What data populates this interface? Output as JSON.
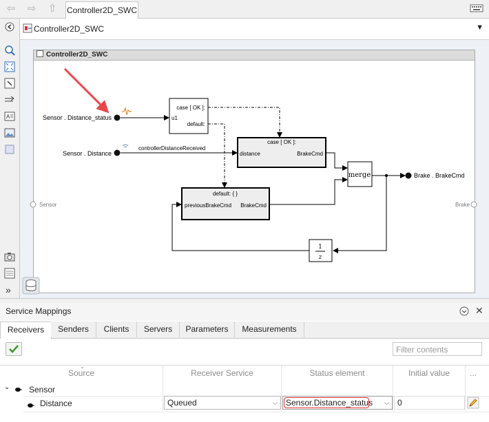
{
  "topbar": {
    "tab_label": "Controller2D_SWC"
  },
  "address": {
    "path": "Controller2D_SWC"
  },
  "subsystem": {
    "title": "Controller2D_SWC"
  },
  "diagram": {
    "port_left": "Sensor",
    "port_right": "Brake",
    "sig_status": "Sensor . Distance_status",
    "sig_distance": "Sensor . Distance",
    "sig_brake": "Brake . BrakeCmd",
    "line_label": "controllerDistanceReceived",
    "switch_case": "case [ OK ]:",
    "switch_default": "default:",
    "switch_input": "u1",
    "case_block_title": "case [ OK ]:",
    "case_in": "distance",
    "case_out": "BrakeCmd",
    "default_block_title": "default: { }",
    "default_in": "previousBrakeCmd",
    "default_out": "BrakeCmd",
    "merge_label": "merge",
    "delay_num": "1",
    "delay_den": "z"
  },
  "panel": {
    "title": "Service Mappings",
    "tabs": [
      "Receivers",
      "Senders",
      "Clients",
      "Servers",
      "Parameters",
      "Measurements"
    ],
    "filter_placeholder": "Filter contents",
    "columns": [
      "Source",
      "Receiver Service",
      "Status element",
      "Initial value",
      "..."
    ],
    "group": "Sensor",
    "row": {
      "source": "Distance",
      "receiver_service": "Queued",
      "status_element": "Sensor.Distance_status",
      "initial_value": "0"
    }
  },
  "colors": {
    "annotation_arrow": "#e8474a",
    "status_highlight": "#e03030",
    "accent": "#2a6ebb"
  }
}
